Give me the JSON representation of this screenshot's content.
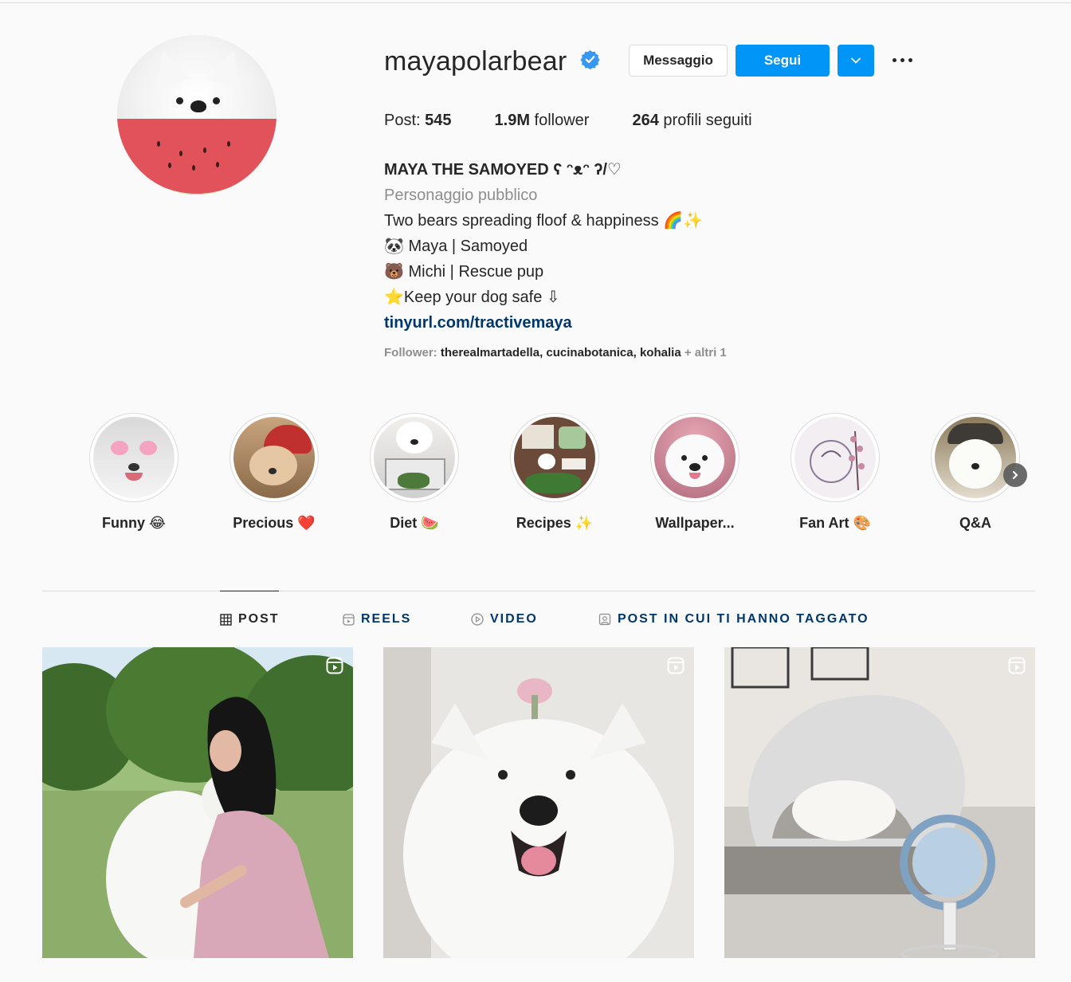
{
  "profile": {
    "username": "mayapolarbear",
    "verified": true,
    "buttons": {
      "message": "Messaggio",
      "follow": "Segui"
    },
    "stats": {
      "posts_label": "Post:",
      "posts_value": "545",
      "followers_value": "1.9M",
      "followers_label": "follower",
      "following_value": "264",
      "following_label": "profili seguiti"
    },
    "bio": {
      "name": "MAYA THE SAMOYED ʕ ᵔᴥᵔ ʔ/♡",
      "category": "Personaggio pubblico",
      "lines": [
        "Two bears spreading floof & happiness 🌈✨",
        "🐼 Maya | Samoyed",
        "🐻 Michi | Rescue pup",
        "⭐Keep your dog safe ⇩"
      ],
      "link": "tinyurl.com/tractivemaya"
    },
    "followed_by": {
      "prefix": "Follower:",
      "users": [
        "therealmartadella",
        "cucinabotanica",
        "kohalia"
      ],
      "more": "+ altri 1"
    }
  },
  "highlights": [
    {
      "label": "Funny 😂",
      "icon": "heart-glasses-dog"
    },
    {
      "label": "Precious ❤️",
      "icon": "dog-red-hat"
    },
    {
      "label": "Diet 🍉",
      "icon": "dog-with-food"
    },
    {
      "label": "Recipes ✨",
      "icon": "ingredients"
    },
    {
      "label": "Wallpaper...",
      "icon": "dog-flowers"
    },
    {
      "label": "Fan Art 🎨",
      "icon": "dog-sketch"
    },
    {
      "label": "Q&A",
      "icon": "dog-with-hat"
    }
  ],
  "tabs": [
    {
      "label": "POST",
      "icon": "grid-icon",
      "active": true
    },
    {
      "label": "REELS",
      "icon": "reels-icon",
      "active": false
    },
    {
      "label": "VIDEO",
      "icon": "play-icon",
      "active": false
    },
    {
      "label": "POST IN CUI TI HANNO TAGGATO",
      "icon": "tag-icon",
      "active": false
    }
  ],
  "posts": [
    {
      "type": "reel",
      "subject": "woman kissing samoyed in park"
    },
    {
      "type": "reel",
      "subject": "smiling samoyed close-up"
    },
    {
      "type": "reel",
      "subject": "dog sleeping under blanket with fan"
    }
  ],
  "colors": {
    "accent": "#0095f6",
    "link": "#00376b",
    "muted": "#8e8e8e",
    "text": "#262626",
    "bg": "#fafafa"
  }
}
